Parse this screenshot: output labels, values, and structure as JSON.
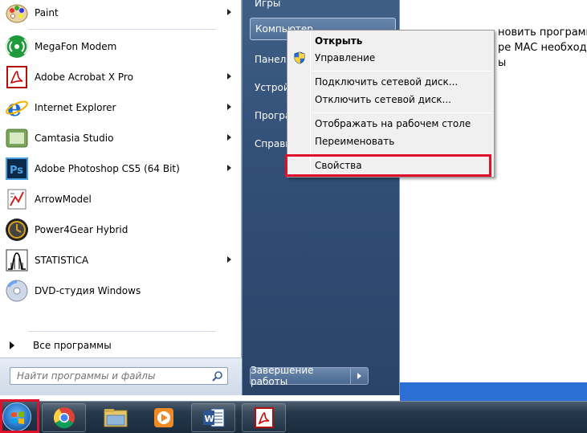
{
  "background_doc": {
    "lines": [
      "новить программу",
      "ре MAC необходим",
      "ы"
    ]
  },
  "start_menu": {
    "pinned": [
      {
        "label": "Paint",
        "icon": "paint-palette-icon",
        "submenu": true
      },
      {
        "label": "MegaFon Modem",
        "icon": "megafon-modem-icon",
        "submenu": false
      },
      {
        "label": "Adobe Acrobat X Pro",
        "icon": "adobe-acrobat-icon",
        "submenu": true
      },
      {
        "label": "Internet Explorer",
        "icon": "internet-explorer-icon",
        "submenu": true
      },
      {
        "label": "Camtasia Studio",
        "icon": "camtasia-icon",
        "submenu": true
      },
      {
        "label": "Adobe Photoshop CS5 (64 Bit)",
        "icon": "photoshop-icon",
        "submenu": true
      },
      {
        "label": "ArrowModel",
        "icon": "arrowmodel-icon",
        "submenu": false
      },
      {
        "label": "Power4Gear Hybrid",
        "icon": "power4gear-icon",
        "submenu": false
      },
      {
        "label": "STATISTICA",
        "icon": "statistica-icon",
        "submenu": true
      },
      {
        "label": "DVD-студия Windows",
        "icon": "dvd-studio-icon",
        "submenu": false
      }
    ],
    "all_programs": "Все программы",
    "search_placeholder": "Найти программы и файлы",
    "right_items": [
      "Игры",
      "Компьютер",
      "Панель",
      "Устрой",
      "Програ",
      "Справк"
    ],
    "shutdown_label": "Завершение работы"
  },
  "context_menu": {
    "items": [
      {
        "label": "Открыть",
        "bold": true
      },
      {
        "label": "Управление",
        "icon": "uac-shield-icon"
      },
      {
        "label": "Подключить сетевой диск..."
      },
      {
        "label": "Отключить сетевой диск..."
      },
      {
        "label": "Отображать на рабочем столе"
      },
      {
        "label": "Переименовать"
      },
      {
        "label": "Свойства"
      }
    ]
  },
  "taskbar": {
    "buttons": [
      {
        "icon": "chrome-icon"
      },
      {
        "icon": "file-explorer-icon"
      },
      {
        "icon": "media-player-icon"
      },
      {
        "icon": "word-icon"
      },
      {
        "icon": "adobe-reader-icon"
      }
    ]
  }
}
